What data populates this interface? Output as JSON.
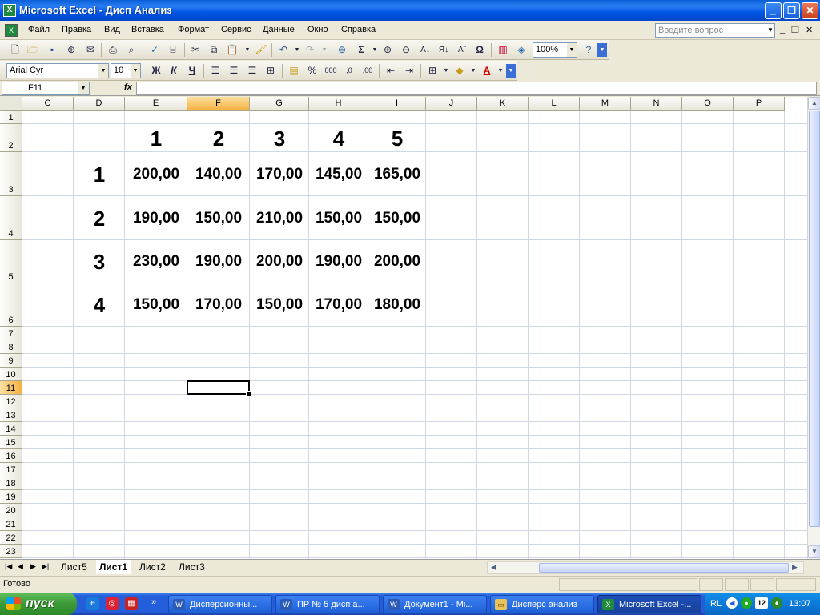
{
  "window": {
    "title": "Microsoft Excel - Дисп Анализ",
    "min_label": "_",
    "max_label": "❐",
    "close_label": "✕"
  },
  "menu": {
    "items": [
      "Файл",
      "Правка",
      "Вид",
      "Вставка",
      "Формат",
      "Сервис",
      "Данные",
      "Окно",
      "Справка"
    ],
    "help_placeholder": "Введите вопрос",
    "doc_min": "_",
    "doc_restore": "❐",
    "doc_close": "✕"
  },
  "toolbar": {
    "zoom": "100%",
    "font": "Arial Cyr",
    "font_size": "10",
    "bold_label": "Ж",
    "italic_label": "К",
    "underline_label": "Ч",
    "sum_label": "Σ",
    "omega_label": "Ω",
    "percent_label": "%",
    "thousands_label": "000",
    "inc_dec_label": ",0",
    "dec_dec_label": ",00"
  },
  "formula_bar": {
    "name_box": "F11",
    "fx": "fx",
    "formula": ""
  },
  "columns": [
    "C",
    "D",
    "E",
    "F",
    "G",
    "H",
    "I",
    "J",
    "K",
    "L",
    "M",
    "N",
    "O",
    "P"
  ],
  "active_column": "F",
  "rows": [
    "1",
    "2",
    "3",
    "4",
    "5",
    "6",
    "7",
    "8",
    "9",
    "10",
    "11",
    "12",
    "13",
    "14",
    "15",
    "16",
    "17",
    "18",
    "19",
    "20",
    "21",
    "22",
    "23"
  ],
  "active_row": "11",
  "table": {
    "header": [
      "1",
      "2",
      "3",
      "4",
      "5"
    ],
    "row_labels": [
      "1",
      "2",
      "3",
      "4"
    ],
    "values": [
      [
        "200,00",
        "140,00",
        "170,00",
        "145,00",
        "165,00"
      ],
      [
        "190,00",
        "150,00",
        "210,00",
        "150,00",
        "150,00"
      ],
      [
        "230,00",
        "190,00",
        "200,00",
        "190,00",
        "200,00"
      ],
      [
        "150,00",
        "170,00",
        "150,00",
        "170,00",
        "180,00"
      ]
    ]
  },
  "sheets": {
    "tabs": [
      "Лист5",
      "Лист1",
      "Лист2",
      "Лист3"
    ],
    "active": "Лист1"
  },
  "status": {
    "text": "Готово"
  },
  "taskbar": {
    "start_label": "пуск",
    "tasks": [
      "Дисперсионны...",
      "ПР № 5 дисп а...",
      "Документ1 - Mi...",
      "Дисперс анализ",
      "Microsoft Excel -..."
    ],
    "active_task": 4,
    "chevron": "»",
    "lang": "RL",
    "tray_number": "12",
    "clock": "13:07"
  },
  "colors": {
    "title_blue": "#0055e5",
    "taskbar_blue": "#245edb",
    "start_green": "#3c9a38",
    "active_header": "#f5b243",
    "grid_line": "#d0d7e5"
  }
}
